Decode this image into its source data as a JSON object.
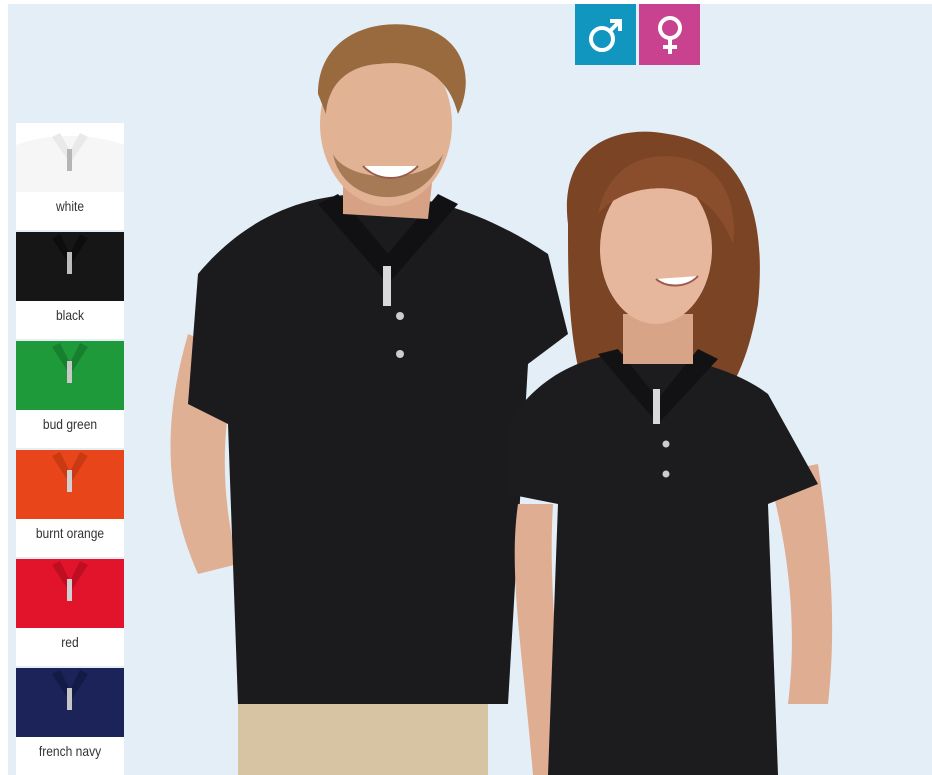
{
  "gender_toggle": {
    "male": {
      "icon": "male-symbol-icon",
      "color": "#1196c0"
    },
    "female": {
      "icon": "female-symbol-icon",
      "color": "#c8428f"
    }
  },
  "swatches": [
    {
      "label": "white",
      "color": "#f6f6f6",
      "collar": "#e9e9e9"
    },
    {
      "label": "black",
      "color": "#161616",
      "collar": "#0d0d0d"
    },
    {
      "label": "bud green",
      "color": "#1f9a3b",
      "collar": "#17802f"
    },
    {
      "label": "burnt orange",
      "color": "#e8461a",
      "collar": "#c93912"
    },
    {
      "label": "red",
      "color": "#e1142c",
      "collar": "#bf0e22"
    },
    {
      "label": "french navy",
      "color": "#1b2358",
      "collar": "#121a45"
    }
  ],
  "background_color": "#e4eef6"
}
